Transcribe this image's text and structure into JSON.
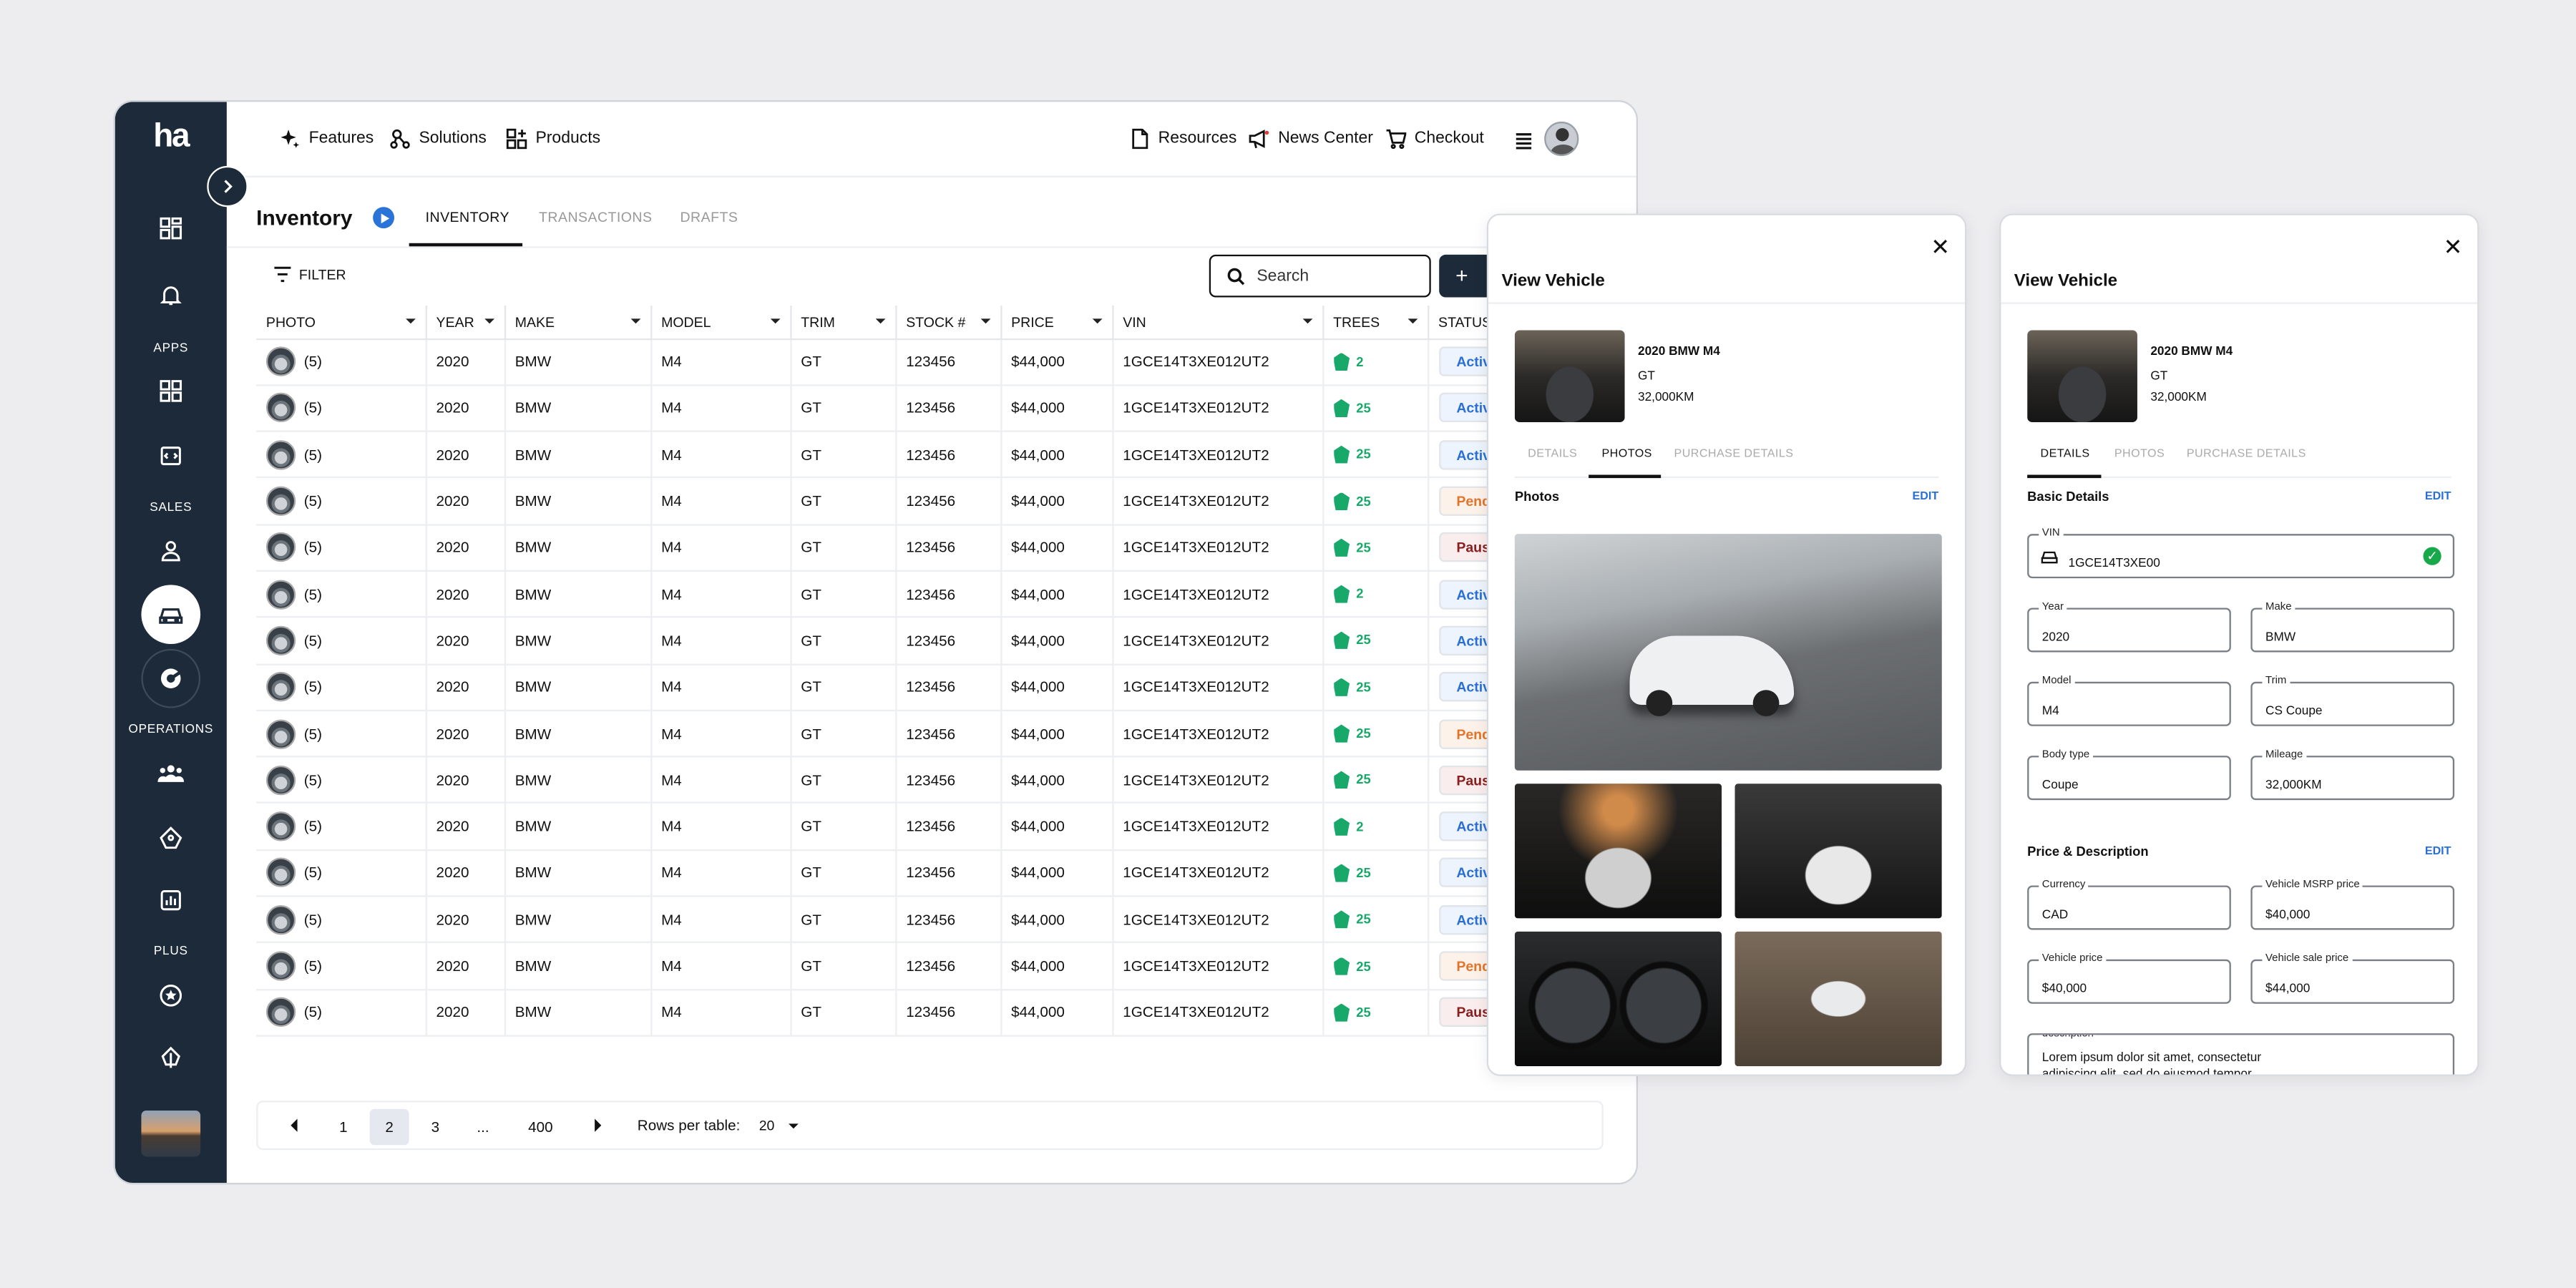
{
  "app": {
    "logo": "ha"
  },
  "sidebar": {
    "sections": [
      "APPS",
      "SALES",
      "OPERATIONS",
      "PLUS"
    ]
  },
  "topnav": {
    "left": [
      {
        "label": "Features",
        "icon": "sparkle-icon"
      },
      {
        "label": "Solutions",
        "icon": "nodes-icon"
      },
      {
        "label": "Products",
        "icon": "grid-plus-icon"
      }
    ],
    "right": [
      {
        "label": "Resources",
        "icon": "document-icon"
      },
      {
        "label": "News Center",
        "icon": "megaphone-icon"
      },
      {
        "label": "Checkout",
        "icon": "cart-icon"
      }
    ]
  },
  "page": {
    "title": "Inventory",
    "tabs": [
      "INVENTORY",
      "TRANSACTIONS",
      "DRAFTS"
    ],
    "filter": "FILTER",
    "search_placeholder": "Search",
    "add": "+"
  },
  "table": {
    "columns": [
      "PHOTO",
      "YEAR",
      "MAKE",
      "MODEL",
      "TRIM",
      "STOCK #",
      "PRICE",
      "VIN",
      "TREES",
      "STATUS"
    ],
    "rows": [
      [
        "(5)",
        "2020",
        "BMW",
        "M4",
        "GT",
        "123456",
        "$44,000",
        "1GCE14T3XE012UT2",
        "2",
        "Active"
      ],
      [
        "(5)",
        "2020",
        "BMW",
        "M4",
        "GT",
        "123456",
        "$44,000",
        "1GCE14T3XE012UT2",
        "25",
        "Active"
      ],
      [
        "(5)",
        "2020",
        "BMW",
        "M4",
        "GT",
        "123456",
        "$44,000",
        "1GCE14T3XE012UT2",
        "25",
        "Active"
      ],
      [
        "(5)",
        "2020",
        "BMW",
        "M4",
        "GT",
        "123456",
        "$44,000",
        "1GCE14T3XE012UT2",
        "25",
        "Pending"
      ],
      [
        "(5)",
        "2020",
        "BMW",
        "M4",
        "GT",
        "123456",
        "$44,000",
        "1GCE14T3XE012UT2",
        "25",
        "Paused"
      ],
      [
        "(5)",
        "2020",
        "BMW",
        "M4",
        "GT",
        "123456",
        "$44,000",
        "1GCE14T3XE012UT2",
        "2",
        "Active"
      ],
      [
        "(5)",
        "2020",
        "BMW",
        "M4",
        "GT",
        "123456",
        "$44,000",
        "1GCE14T3XE012UT2",
        "25",
        "Active"
      ],
      [
        "(5)",
        "2020",
        "BMW",
        "M4",
        "GT",
        "123456",
        "$44,000",
        "1GCE14T3XE012UT2",
        "25",
        "Active"
      ],
      [
        "(5)",
        "2020",
        "BMW",
        "M4",
        "GT",
        "123456",
        "$44,000",
        "1GCE14T3XE012UT2",
        "25",
        "Pending"
      ],
      [
        "(5)",
        "2020",
        "BMW",
        "M4",
        "GT",
        "123456",
        "$44,000",
        "1GCE14T3XE012UT2",
        "25",
        "Paused"
      ],
      [
        "(5)",
        "2020",
        "BMW",
        "M4",
        "GT",
        "123456",
        "$44,000",
        "1GCE14T3XE012UT2",
        "2",
        "Active"
      ],
      [
        "(5)",
        "2020",
        "BMW",
        "M4",
        "GT",
        "123456",
        "$44,000",
        "1GCE14T3XE012UT2",
        "25",
        "Active"
      ],
      [
        "(5)",
        "2020",
        "BMW",
        "M4",
        "GT",
        "123456",
        "$44,000",
        "1GCE14T3XE012UT2",
        "25",
        "Active"
      ],
      [
        "(5)",
        "2020",
        "BMW",
        "M4",
        "GT",
        "123456",
        "$44,000",
        "1GCE14T3XE012UT2",
        "25",
        "Pending"
      ],
      [
        "(5)",
        "2020",
        "BMW",
        "M4",
        "GT",
        "123456",
        "$44,000",
        "1GCE14T3XE012UT2",
        "25",
        "Paused"
      ]
    ]
  },
  "pagination": {
    "pages": [
      "1",
      "2",
      "3",
      "...",
      "400"
    ],
    "current": "2",
    "rows_label": "Rows per table:",
    "rows_value": "20"
  },
  "view_vehicle": {
    "title": "View Vehicle",
    "name": "2020 BMW M4",
    "trim": "GT",
    "mileage": "32,000KM",
    "tabs": [
      "DETAILS",
      "PHOTOS",
      "PURCHASE DETAILS"
    ],
    "photos_title": "Photos",
    "edit": "EDIT",
    "basic_title": "Basic Details",
    "fields": {
      "vin": {
        "label": "VIN",
        "value": "1GCE14T3XE00"
      },
      "year": {
        "label": "Year",
        "value": "2020"
      },
      "make": {
        "label": "Make",
        "value": "BMW"
      },
      "model": {
        "label": "Model",
        "value": "M4"
      },
      "trim": {
        "label": "Trim",
        "value": "CS Coupe"
      },
      "body": {
        "label": "Body type",
        "value": "Coupe"
      },
      "mileage": {
        "label": "Mileage",
        "value": "32,000KM"
      }
    },
    "price_title": "Price & Description",
    "price_fields": {
      "currency": {
        "label": "Currency",
        "value": "CAD"
      },
      "msrp": {
        "label": "Vehicle MSRP price",
        "value": "$40,000"
      },
      "price": {
        "label": "Vehicle price",
        "value": "$40,000"
      },
      "sale": {
        "label": "Vehicle sale price",
        "value": "$44,000"
      },
      "desc": {
        "label": "description",
        "value": "Lorem ipsum dolor sit amet, consectetur adipiscing elit, sed do eiusmod tempor"
      }
    }
  },
  "colors": {
    "sidebar": "#1c2a3a",
    "accent": "#2a73d9",
    "trees": "#17a86a",
    "active": "#2a6fd6",
    "pending": "#e3742b",
    "paused": "#8a1f1f"
  }
}
